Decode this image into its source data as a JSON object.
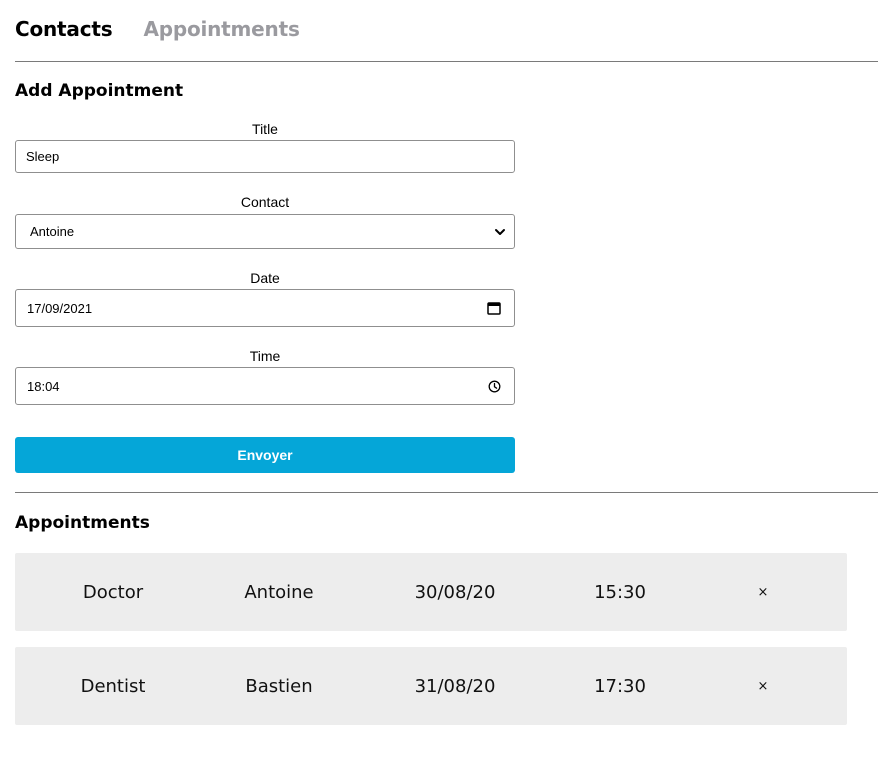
{
  "nav": {
    "contacts_label": "Contacts",
    "appointments_label": "Appointments"
  },
  "form": {
    "title": "Add Appointment",
    "fields": {
      "title": {
        "label": "Title",
        "value": "Sleep"
      },
      "contact": {
        "label": "Contact",
        "selected": "Antoine"
      },
      "date": {
        "label": "Date",
        "value": "17/09/2021"
      },
      "time": {
        "label": "Time",
        "value": "18:04"
      }
    },
    "submit_label": "Envoyer"
  },
  "appointments": {
    "title": "Appointments",
    "rows": [
      {
        "title": "Doctor",
        "contact": "Antoine",
        "date": "30/08/20",
        "time": "15:30",
        "remove": "×"
      },
      {
        "title": "Dentist",
        "contact": "Bastien",
        "date": "31/08/20",
        "time": "17:30",
        "remove": "×"
      }
    ]
  },
  "colors": {
    "accent": "#05a6d8",
    "row_background": "#ededed",
    "inactive_tab": "#9a9a9f"
  },
  "icons": {
    "select": "chevron-down-icon",
    "date": "calendar-icon",
    "time": "clock-icon",
    "remove": "close-icon"
  }
}
